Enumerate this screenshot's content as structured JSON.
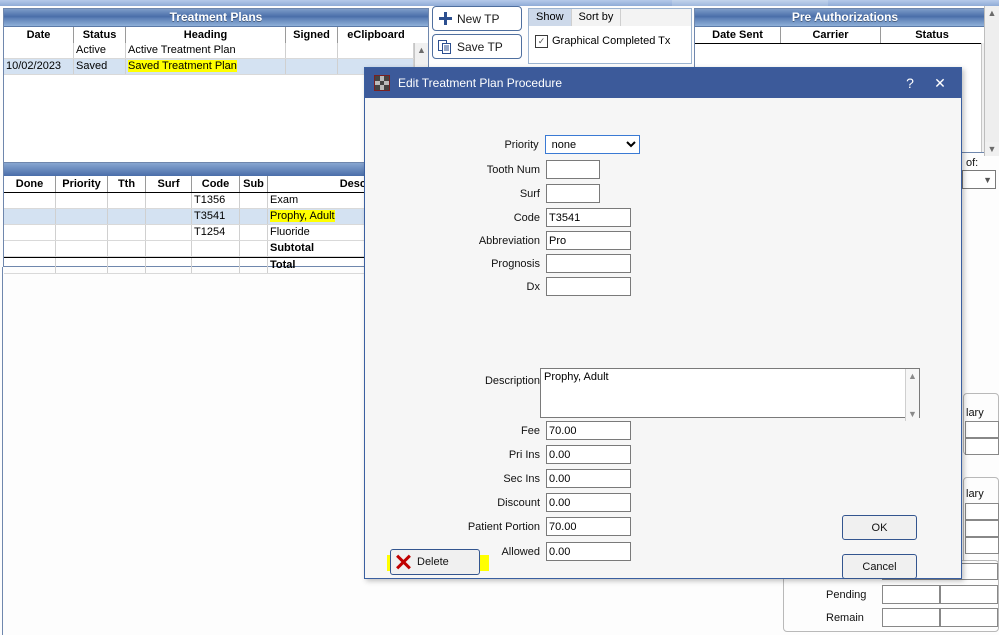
{
  "treatment_plans": {
    "title": "Treatment Plans",
    "columns": [
      "Date",
      "Status",
      "Heading",
      "Signed",
      "eClipboard"
    ],
    "rows": [
      {
        "date": "",
        "status": "Active",
        "heading": "Active Treatment Plan",
        "signed": "",
        "eclipboard": "",
        "selected": false,
        "highlight": false
      },
      {
        "date": "10/02/2023",
        "status": "Saved",
        "heading": "Saved Treatment Plan",
        "signed": "",
        "eclipboard": "",
        "selected": true,
        "highlight": true
      }
    ]
  },
  "toolbar": {
    "new_tp_label": "New TP",
    "save_tp_label": "Save TP"
  },
  "show_box": {
    "tabs": [
      {
        "label": "Show",
        "active": true
      },
      {
        "label": "Sort by",
        "active": false
      }
    ],
    "checkbox_label": "Graphical Completed Tx",
    "checkbox_checked": true,
    "check_glyph": "✓"
  },
  "pre_authorizations": {
    "title": "Pre Authorizations",
    "columns": [
      "Date Sent",
      "Carrier",
      "Status"
    ],
    "rows": []
  },
  "procedures": {
    "columns": [
      "Done",
      "Priority",
      "Tth",
      "Surf",
      "Code",
      "Sub",
      "Desc"
    ],
    "rows": [
      {
        "done": "",
        "priority": "",
        "tth": "",
        "surf": "",
        "code": "T1356",
        "sub": "",
        "desc": "Exam",
        "selected": false,
        "highlight": false,
        "bold": false
      },
      {
        "done": "",
        "priority": "",
        "tth": "",
        "surf": "",
        "code": "T3541",
        "sub": "",
        "desc": "Prophy, Adult",
        "selected": true,
        "highlight": true,
        "bold": false
      },
      {
        "done": "",
        "priority": "",
        "tth": "",
        "surf": "",
        "code": "T1254",
        "sub": "",
        "desc": "Fluoride",
        "selected": false,
        "highlight": false,
        "bold": false
      },
      {
        "done": "",
        "priority": "",
        "tth": "",
        "surf": "",
        "code": "",
        "sub": "",
        "desc": "Subtotal",
        "selected": false,
        "highlight": false,
        "bold": true
      },
      {
        "done": "",
        "priority": "",
        "tth": "",
        "surf": "",
        "code": "",
        "sub": "",
        "desc": "Total",
        "selected": false,
        "highlight": false,
        "bold": true
      }
    ]
  },
  "right_panel": {
    "of_label": "of:",
    "primary_label_1": "lary",
    "primary_label_2": "lary",
    "pending_label": "Pending",
    "remain_label": "Remain"
  },
  "dialog": {
    "title": "Edit Treatment Plan Procedure",
    "help_glyph": "?",
    "close_glyph": "✕",
    "fields": [
      {
        "label": "Priority",
        "value": "none",
        "type": "select"
      },
      {
        "label": "Tooth Num",
        "value": "",
        "type": "text"
      },
      {
        "label": "Surf",
        "value": "",
        "type": "text"
      },
      {
        "label": "Code",
        "value": "T3541",
        "type": "text"
      },
      {
        "label": "Abbreviation",
        "value": "Pro",
        "type": "text"
      },
      {
        "label": "Prognosis",
        "value": "",
        "type": "text"
      },
      {
        "label": "Dx",
        "value": "",
        "type": "text"
      },
      {
        "label": "Description",
        "value": "Prophy, Adult",
        "type": "textarea"
      },
      {
        "label": "Fee",
        "value": "70.00",
        "type": "text"
      },
      {
        "label": "Pri Ins",
        "value": "0.00",
        "type": "text"
      },
      {
        "label": "Sec Ins",
        "value": "0.00",
        "type": "text"
      },
      {
        "label": "Discount",
        "value": "0.00",
        "type": "text"
      },
      {
        "label": "Patient Portion",
        "value": "70.00",
        "type": "text"
      },
      {
        "label": "Allowed",
        "value": "0.00",
        "type": "text"
      }
    ],
    "priority_options": [
      "none"
    ],
    "buttons": {
      "ok": "OK",
      "cancel": "Cancel",
      "delete": "Delete"
    }
  },
  "colors": {
    "title_bar": "#3c5a9a",
    "panel_header_blue": "#4a6ea9",
    "highlight_yellow": "#ffff00",
    "selected_row": "#d4e2f2",
    "delete_x_red": "#c00000",
    "accent_border": "#33558f"
  }
}
